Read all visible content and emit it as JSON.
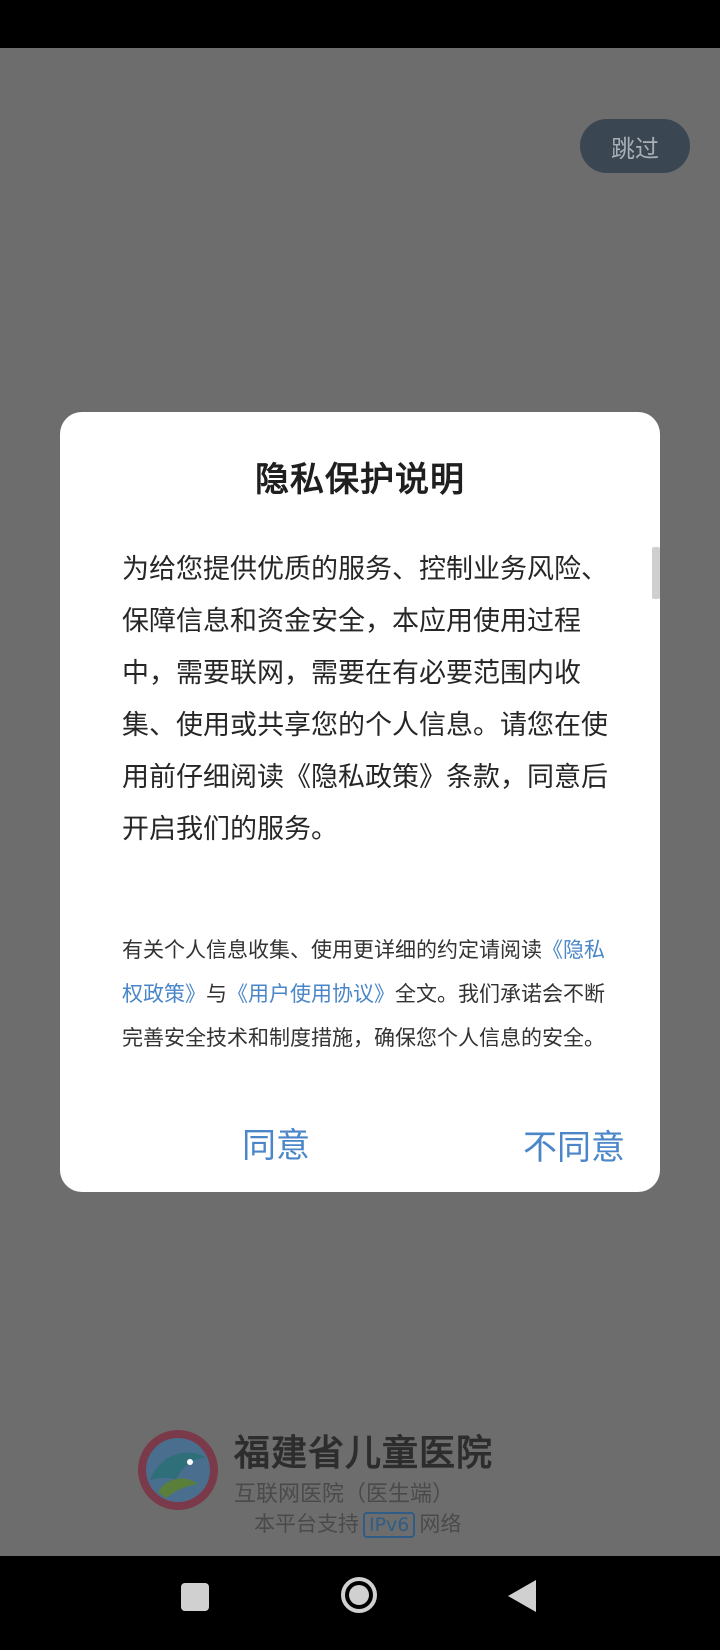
{
  "skip_label": "跳过",
  "dialog": {
    "title": "隐私保护说明",
    "body": "为给您提供优质的服务、控制业务风险、保障信息和资金安全，本应用使用过程中，需要联网，需要在有必要范围内收集、使用或共享您的个人信息。请您在使用前仔细阅读《隐私政策》条款，同意后开启我们的服务。",
    "detail_prefix": "有关个人信息收集、使用更详细的约定请阅读",
    "privacy_link": "《隐私权政策》",
    "conjunction": "与",
    "agreement_link": "《用户使用协议》",
    "detail_suffix": "全文。我们承诺会不断完善安全技术和制度措施，确保您个人信息的安全。",
    "agree_label": "同意",
    "disagree_label": "不同意"
  },
  "brand": {
    "name": "福建省儿童医院",
    "subtitle": "互联网医院（医生端）",
    "ipv6_prefix": "本平台支持",
    "ipv6_badge": "IPv6",
    "ipv6_suffix": "网络"
  },
  "colors": {
    "overlay": "#6d6d6d",
    "link": "#4a86c8",
    "skip_bg": "#3a4652"
  },
  "icons": {
    "recent_apps": "square-icon",
    "home": "circle-home-icon",
    "back": "triangle-back-icon",
    "logo": "hospital-dolphin-logo"
  }
}
